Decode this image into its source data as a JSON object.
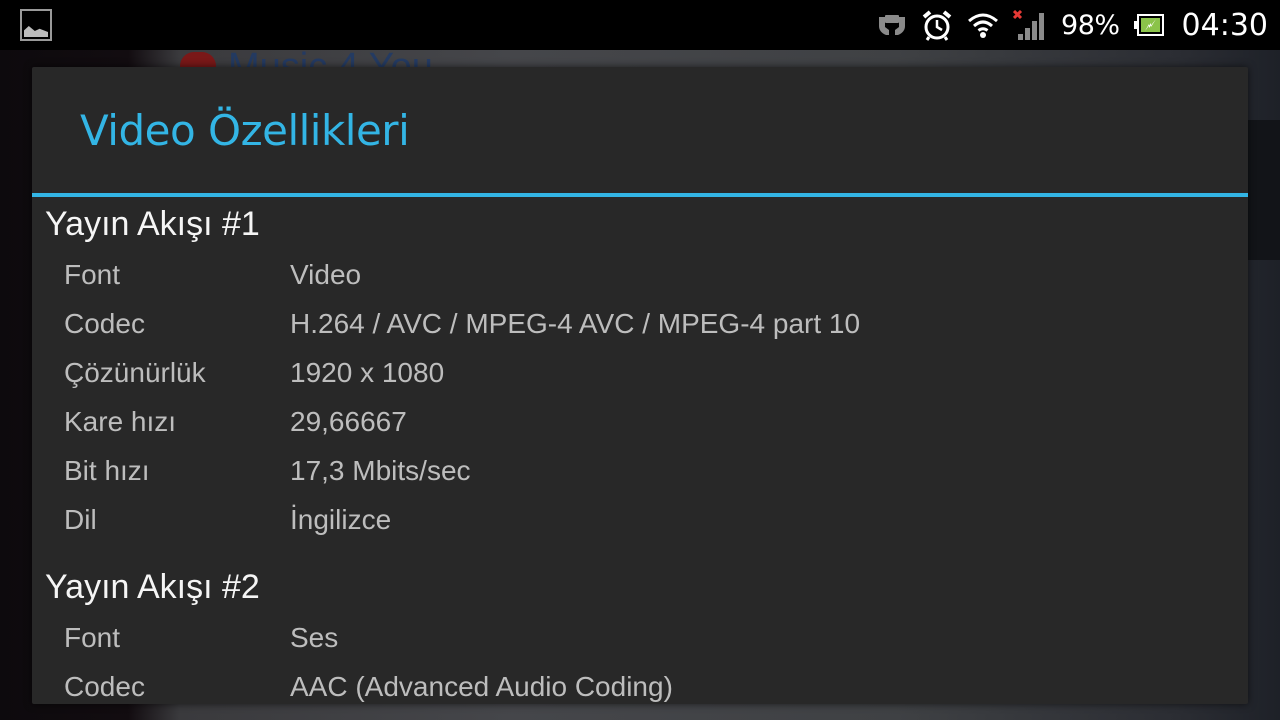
{
  "status_bar": {
    "left_icon": "image-notification-icon",
    "icons": [
      "nfc-icon",
      "alarm-icon",
      "wifi-icon",
      "signal-no-sim-icon"
    ],
    "battery_percent": "98%",
    "battery_icon": "battery-charging-icon",
    "time": "04:30",
    "colors": {
      "signal_x": "#e53935",
      "battery_fill": "#8bc34a"
    }
  },
  "background": {
    "app_title": "Music 4 You"
  },
  "dialog": {
    "title": "Video Özellikleri",
    "accent_color": "#33b5e5",
    "sections": [
      {
        "title": "Yayın Akışı #1",
        "rows": [
          {
            "label": "Font",
            "value": "Video"
          },
          {
            "label": "Codec",
            "value": "H.264 / AVC / MPEG-4 AVC / MPEG-4 part 10"
          },
          {
            "label": "Çözünürlük",
            "value": "1920 x 1080"
          },
          {
            "label": "Kare hızı",
            "value": "29,66667"
          },
          {
            "label": "Bit hızı",
            "value": "17,3 Mbits/sec"
          },
          {
            "label": "Dil",
            "value": "İngilizce"
          }
        ]
      },
      {
        "title": "Yayın Akışı #2",
        "rows": [
          {
            "label": "Font",
            "value": "Ses"
          },
          {
            "label": "Codec",
            "value": "AAC (Advanced Audio Coding)"
          }
        ]
      }
    ]
  }
}
